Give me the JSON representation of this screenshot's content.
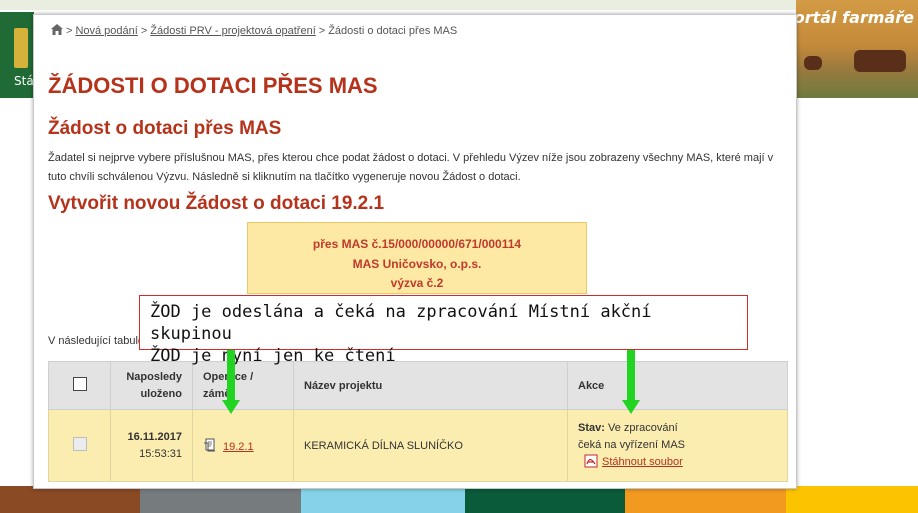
{
  "background": {
    "logo_text": "Stá",
    "banner_title": "Portál farmáře",
    "bottom_bar_colors": [
      "#8a4a24",
      "#767b7d",
      "#85d3e8",
      "#0a5b3a",
      "#f19a1f",
      "#fcc400"
    ]
  },
  "breadcrumb": {
    "home_icon": "home-icon",
    "items": [
      "Nová podání",
      "Žádosti PRV - projektová opatření"
    ],
    "current": "Žádosti o dotaci přes MAS",
    "separator": ">"
  },
  "page_title": "ŽÁDOSTI O DOTACI PŘES MAS",
  "section_title": "Žádost o dotaci přes MAS",
  "intro_text": "Žadatel si nejprve vybere příslušnou MAS, přes kterou chce podat žádost o dotaci. V přehledu Výzev níže jsou zobrazeny všechny MAS, které mají v tuto chvíli schválenou Výzvu. Následně si kliknutím na tlačítko vygeneruje novou Žádost o dotaci.",
  "create_title": "Vytvořit novou Žádost o dotaci 19.2.1",
  "mas_box": {
    "line1": "přes MAS č.15/000/00000/671/000114",
    "line2": "MAS Uničovsko, o.p.s.",
    "line3": "výzva č.2"
  },
  "table_intro": "V následující tabulc",
  "table": {
    "headers": {
      "last_saved": "Naposledy uloženo",
      "operation": "Operace / záměr",
      "project_name": "Název projektu",
      "actions": "Akce"
    },
    "rows": [
      {
        "date": "16.11.2017",
        "time": "15:53:31",
        "operation": "19.2.1",
        "project_name": "KERAMICKÁ DÍLNA SLUNÍČKO",
        "status_label": "Stav:",
        "status_value": "Ve zpracování",
        "status_detail": "čeká na vyřízení MAS",
        "download_label": "Stáhnout soubor"
      }
    ]
  },
  "callout": {
    "line1": "ŽOD je odeslána a čeká na zpracování Místní akční skupinou",
    "line2": "ŽOD je nyní jen ke čtení",
    "border_color": "#d12b2b",
    "arrow_color": "#22d322"
  }
}
